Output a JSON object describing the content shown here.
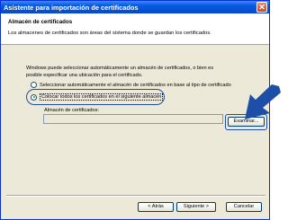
{
  "window": {
    "title": "Asistente para importación de certificados"
  },
  "header": {
    "title": "Almacén de certificados",
    "subtitle": "Los almacenes de certificados son áreas del sistema donde se guardan los certificados."
  },
  "body": {
    "line1": "Windows puede seleccionar automáticamente un almacén de certificados, o bien es",
    "line2": "posible especificar una ubicación para el certificado."
  },
  "options": [
    {
      "label": "Seleccionar automáticamente el almacén de certificados en base al tipo de certificado",
      "checked": false
    },
    {
      "label": "Colocar todos los certificados en el siguiente almacén",
      "checked": true
    }
  ],
  "store": {
    "label": "Almacén de certificados:",
    "value": ""
  },
  "buttons": {
    "browse": "Examinar...",
    "back": "< Atrás",
    "next": "Siguiente >",
    "cancel": "Cancelar"
  },
  "colors": {
    "titlebar": "#0453d9",
    "highlight": "#1e4fa8",
    "arrow": "#1e4fa8"
  }
}
